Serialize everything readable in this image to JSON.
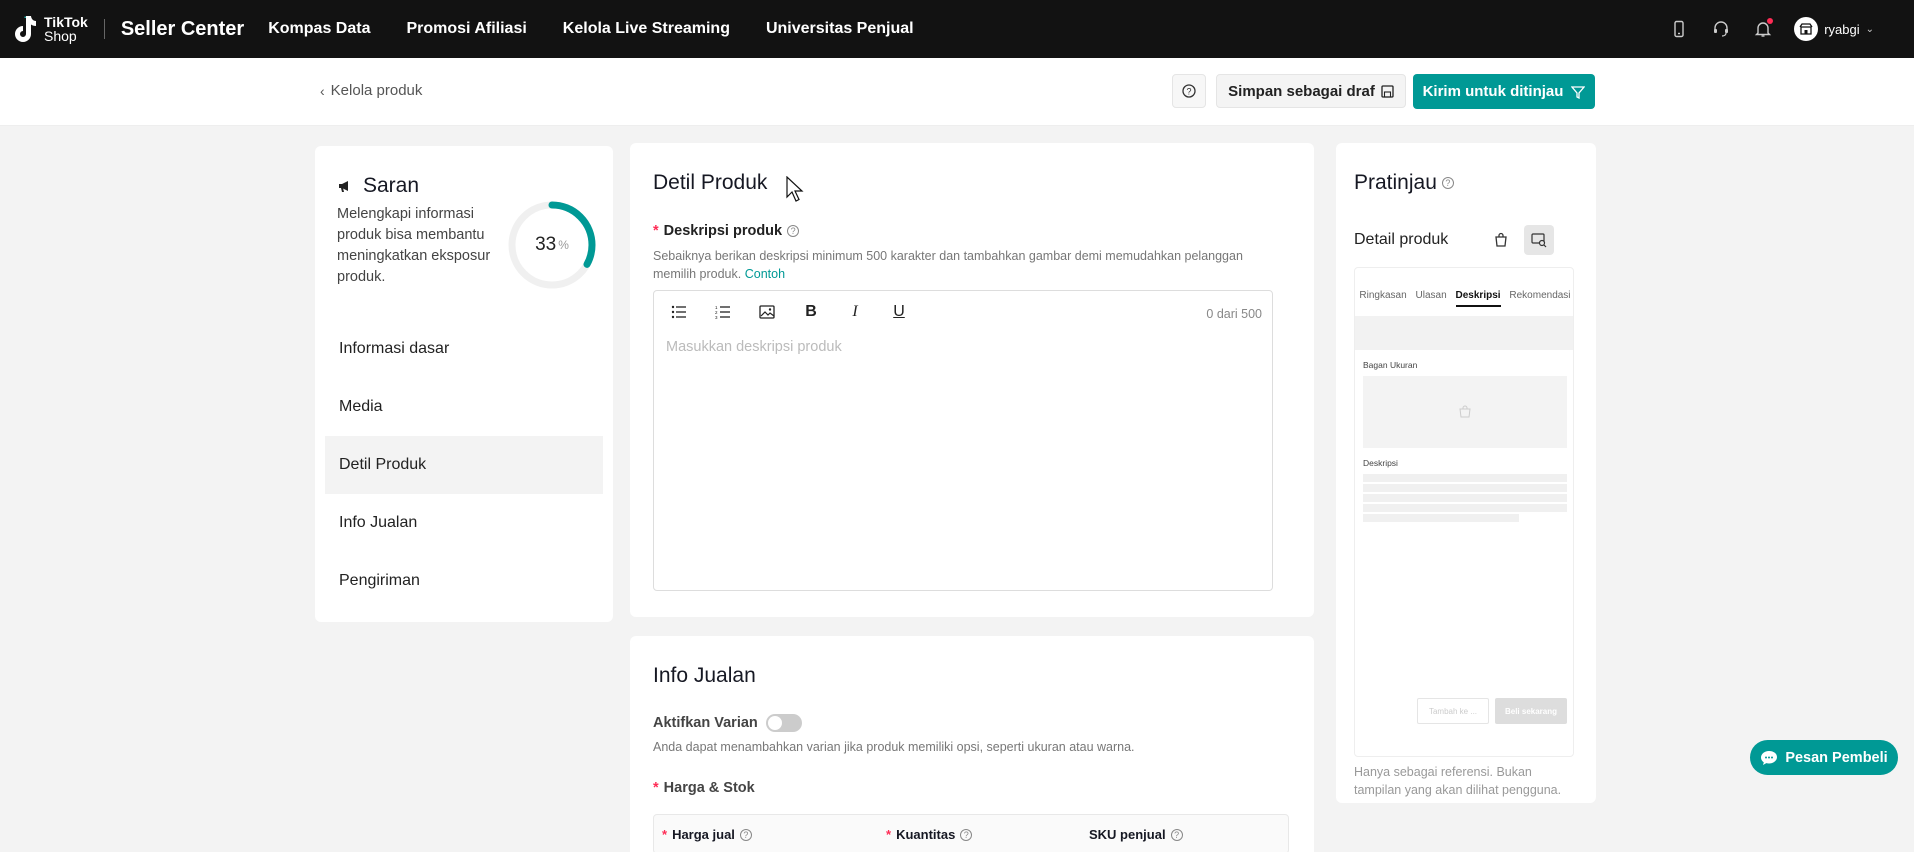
{
  "topbar": {
    "logo_line1": "TikTok",
    "logo_line2": "Shop",
    "product": "Seller Center",
    "nav": [
      "Kompas Data",
      "Promosi Afiliasi",
      "Kelola Live Streaming",
      "Universitas Penjual"
    ],
    "username": "ryabgi",
    "icons": [
      "mobile-icon",
      "headset-icon",
      "bell-icon"
    ]
  },
  "subbar": {
    "back_label": "Kelola produk",
    "draft_label": "Simpan sebagai draf",
    "submit_label": "Kirim untuk ditinjau"
  },
  "saran": {
    "title": "Saran",
    "description": "Melengkapi informasi produk bisa membantu meningkatkan eksposur produk.",
    "progress_value": "33",
    "progress_unit": "%",
    "menu": [
      "Informasi dasar",
      "Media",
      "Detil Produk",
      "Info Jualan",
      "Pengiriman"
    ],
    "active_index": 2
  },
  "detail": {
    "title": "Detil Produk",
    "field_label": "Deskripsi produk",
    "hint": "Sebaiknya berikan deskripsi minimum 500 karakter dan tambahkan gambar demi memudahkan pelanggan memilih produk.",
    "hint_link": "Contoh",
    "counter": "0 dari 500",
    "placeholder": "Masukkan deskripsi produk",
    "toolbar": [
      "bullet-list-icon",
      "numbered-list-icon",
      "image-icon",
      "bold-icon",
      "italic-icon",
      "underline-icon"
    ]
  },
  "jualan": {
    "title": "Info Jualan",
    "variant_label": "Aktifkan Varian",
    "variant_hint": "Anda dapat menambahkan varian jika produk memiliki opsi, seperti ukuran atau warna.",
    "price_stock_label": "Harga & Stok",
    "col_price": "Harga jual",
    "col_qty": "Kuantitas",
    "col_sku": "SKU penjual"
  },
  "preview": {
    "title": "Pratinjau",
    "subtitle": "Detail produk",
    "tabs": [
      "Ringkasan",
      "Ulasan",
      "Deskripsi",
      "Rekomendasi"
    ],
    "active_tab": 2,
    "size_chart_label": "Bagan Ukuran",
    "desc_label": "Deskripsi",
    "cart_btn": "Tambah ke ...",
    "buy_btn": "Beli sekarang",
    "note": "Hanya sebagai referensi. Bukan tampilan yang akan dilihat pengguna."
  },
  "chat": {
    "label": "Pesan Pembeli"
  },
  "colors": {
    "accent": "#009995",
    "topbar": "#121212",
    "required": "#fe2c55"
  }
}
